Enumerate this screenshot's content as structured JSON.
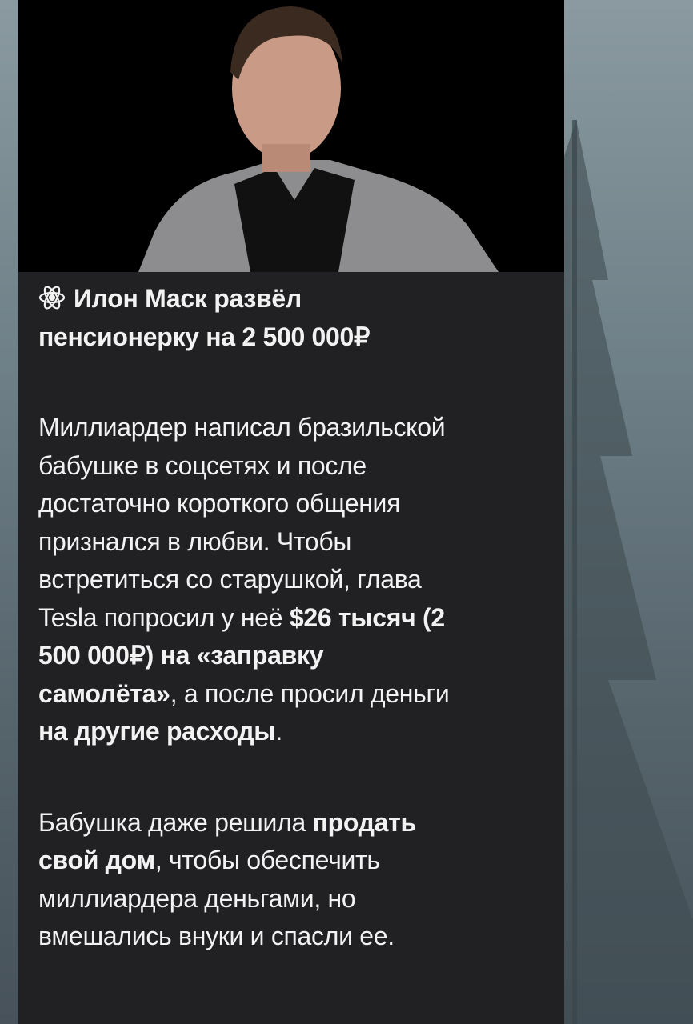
{
  "post": {
    "title_icon": "atom-icon",
    "title_lines": [
      "Илон Маск развёл",
      "пенсионерку на 2 500 000₽"
    ],
    "paragraphs": [
      {
        "lines": [
          [
            {
              "t": "Миллиардер написал бразильской",
              "b": false
            }
          ],
          [
            {
              "t": "бабушке в соцсетях и после",
              "b": false
            }
          ],
          [
            {
              "t": "достаточно короткого общения",
              "b": false
            }
          ],
          [
            {
              "t": "признался в любви. Чтобы",
              "b": false
            }
          ],
          [
            {
              "t": "встретиться со старушкой, глава",
              "b": false
            }
          ],
          [
            {
              "t": "Tesla попросил у неё ",
              "b": false
            },
            {
              "t": "$26 тысяч (2",
              "b": true
            }
          ],
          [
            {
              "t": "500 000₽) на «заправку",
              "b": true
            }
          ],
          [
            {
              "t": "самолёта»",
              "b": true
            },
            {
              "t": ", а после просил деньги",
              "b": false
            }
          ],
          [
            {
              "t": "на другие расходы",
              "b": true
            },
            {
              "t": ".",
              "b": false
            }
          ]
        ]
      },
      {
        "lines": [
          [
            {
              "t": "Бабушка даже решила ",
              "b": false
            },
            {
              "t": "продать",
              "b": true
            }
          ],
          [
            {
              "t": "свой дом",
              "b": true
            },
            {
              "t": ", чтобы обеспечить",
              "b": false
            }
          ],
          [
            {
              "t": "миллиардера деньгами, но",
              "b": false
            }
          ],
          [
            {
              "t": "вмешались внуки и спасли ее.",
              "b": false
            }
          ]
        ]
      }
    ]
  },
  "colors": {
    "bubble": "#212124",
    "text": "#f2f2f2"
  }
}
